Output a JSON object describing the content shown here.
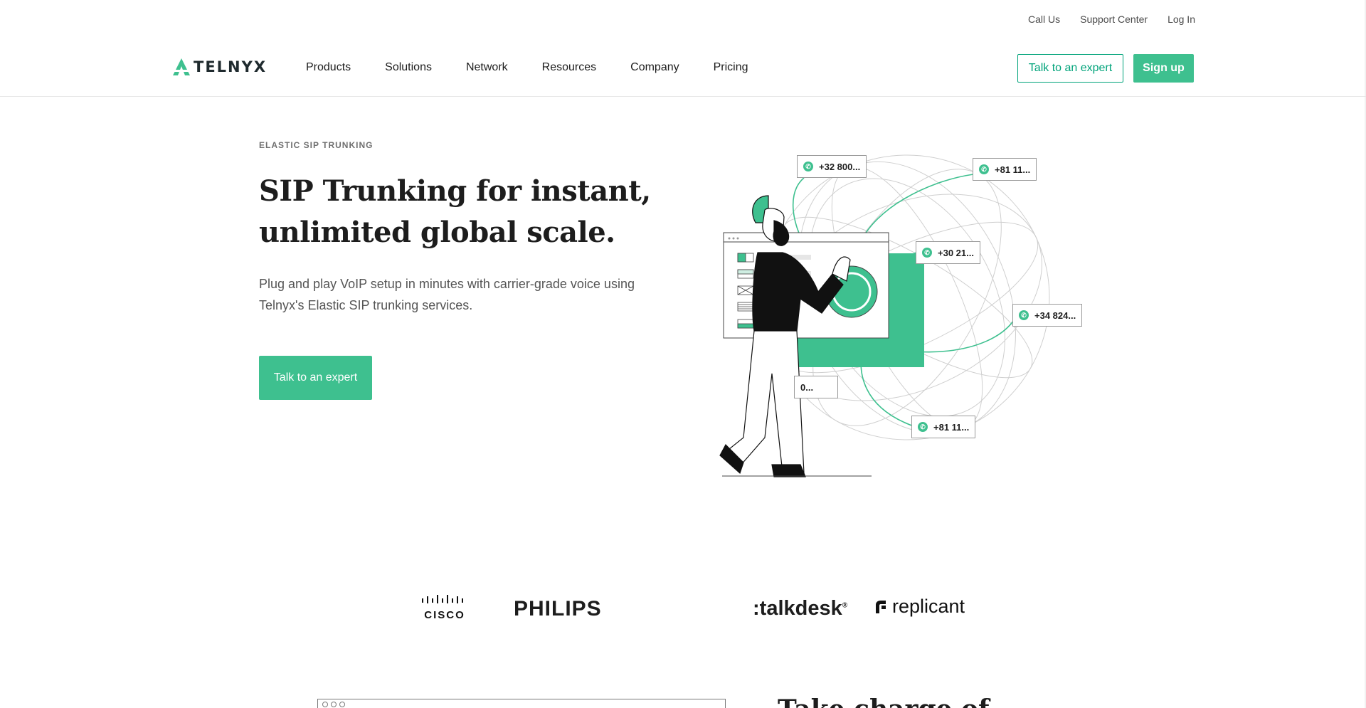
{
  "utility_nav": {
    "call_us": "Call Us",
    "support_center": "Support Center",
    "log_in": "Log In"
  },
  "header": {
    "logo_text": "TELNYX",
    "nav": [
      "Products",
      "Solutions",
      "Network",
      "Resources",
      "Company",
      "Pricing"
    ],
    "talk_to_expert": "Talk to an expert",
    "sign_up": "Sign up"
  },
  "hero": {
    "eyebrow": "ELASTIC SIP TRUNKING",
    "title_line1": "SIP Trunking for instant,",
    "title_line2": "unlimited global scale.",
    "subtitle_line1": "Plug and play VoIP setup in minutes with carrier-grade voice using",
    "subtitle_line2": "Telnyx's Elastic SIP trunking services.",
    "cta": "Talk to an expert"
  },
  "illustration": {
    "tags": [
      "+32 800...",
      "+81 11...",
      "+30 21...",
      "+34 824...",
      "0...",
      "+81 11..."
    ]
  },
  "customer_logos": [
    "CISCO",
    "PHILIPS",
    "talkdesk",
    "replicant"
  ],
  "next_section": {
    "title_peek": "Take charge of"
  },
  "colors": {
    "brand_green": "#3ec08f",
    "brand_green_dark": "#00a37a",
    "text_dark": "#1d1d1d"
  }
}
